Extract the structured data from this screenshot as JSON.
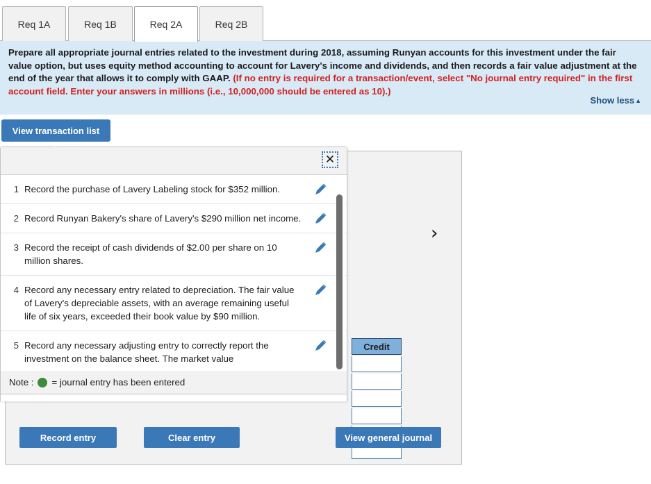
{
  "tabs": [
    {
      "label": "Req 1A",
      "active": false
    },
    {
      "label": "Req 1B",
      "active": false
    },
    {
      "label": "Req 2A",
      "active": true
    },
    {
      "label": "Req 2B",
      "active": false
    }
  ],
  "instructions": {
    "main_text": "Prepare all appropriate journal entries related to the investment during 2018, assuming Runyan accounts for this investment under the fair value option, but uses equity method accounting to account for Lavery's income and dividends, and then records a fair value adjustment at the end of the year that allows it to comply with GAAP. ",
    "red_text": "(If no entry is required for a transaction/event, select \"No journal entry required\" in the first account field. Enter your answers in millions (i.e., 10,000,000 should be entered as 10).)",
    "show_less_label": "Show less",
    "show_less_caret": "▲"
  },
  "transaction_popup": {
    "trigger_label": "View transaction list",
    "close_icon": "✕",
    "items": [
      {
        "number": "1",
        "text": "Record the purchase of Lavery Labeling stock for $352 million."
      },
      {
        "number": "2",
        "text": "Record Runyan Bakery's share of Lavery's $290 million net income."
      },
      {
        "number": "3",
        "text": "Record the receipt of cash dividends of $2.00 per share on 10 million shares."
      },
      {
        "number": "4",
        "text": "Record any necessary entry related to depreciation. The fair value of Lavery's depreciable assets, with an average remaining useful life of six years, exceeded their book value by $90 million."
      },
      {
        "number": "5",
        "text": "Record any necessary adjusting entry to correctly report the investment on the balance sheet. The market value"
      }
    ],
    "note_prefix": "Note :",
    "note_text": "= journal entry has been entered"
  },
  "journal_panel": {
    "next_chevron": "›",
    "credit_header": "Credit",
    "credit_rows": [
      "",
      "",
      "",
      "",
      "",
      ""
    ]
  },
  "actions": {
    "record_entry": "Record entry",
    "clear_entry": "Clear entry",
    "view_general_journal": "View general journal"
  },
  "colors": {
    "accent_blue": "#3b78b8",
    "banner_blue": "#d9eaf7",
    "red_note": "#d32020",
    "credit_header_blue": "#7fb0dc",
    "green_dot": "#3e8b3e",
    "link_blue": "#1f4e79"
  }
}
